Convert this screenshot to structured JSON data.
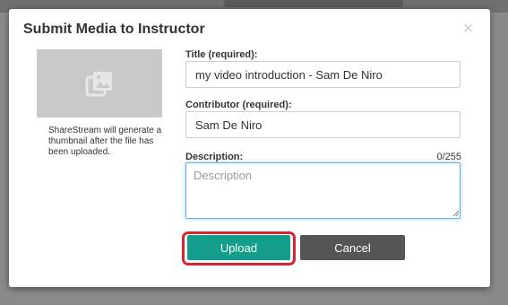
{
  "dialog": {
    "title": "Submit Media to Instructor",
    "close_glyph": "×"
  },
  "thumbnail": {
    "icon": "image-placeholder-icon",
    "caption": "ShareStream will generate a thumbnail after the file has been uploaded."
  },
  "form": {
    "title_label": "Title (required):",
    "title_value": "my video introduction - Sam De Niro",
    "contributor_label": "Contributor (required):",
    "contributor_value": "Sam De Niro",
    "description_label": "Description:",
    "description_placeholder": "Description",
    "description_counter": "0/255"
  },
  "actions": {
    "upload_label": "Upload",
    "cancel_label": "Cancel"
  },
  "colors": {
    "upload_button": "#139d8b",
    "cancel_button": "#555555",
    "highlight_ring": "#d9252f",
    "focus_border": "#66afe9"
  }
}
